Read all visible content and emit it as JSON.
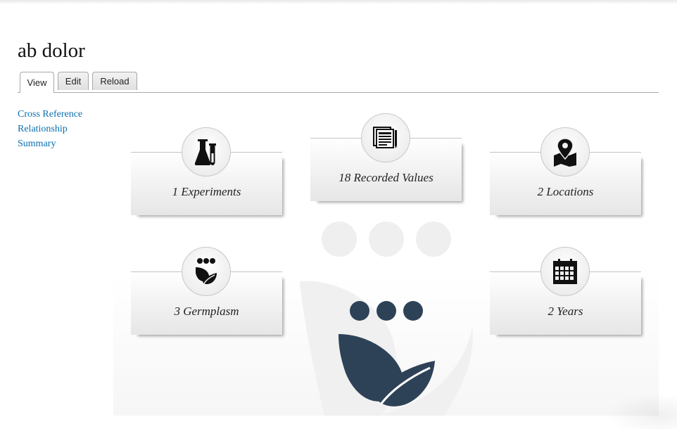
{
  "page": {
    "title": "ab dolor"
  },
  "tabs": [
    {
      "label": "View",
      "active": true
    },
    {
      "label": "Edit",
      "active": false
    },
    {
      "label": "Reload",
      "active": false
    }
  ],
  "sidebar": {
    "links": [
      "Cross Reference",
      "Relationship",
      "Summary"
    ]
  },
  "cards": [
    {
      "label": "1 Experiments",
      "icon": "lab-flask-icon"
    },
    {
      "label": "18 Recorded Values",
      "icon": "documents-icon"
    },
    {
      "label": "2 Locations",
      "icon": "map-pin-icon"
    },
    {
      "label": "3 Germplasm",
      "icon": "germplasm-leaf-icon"
    },
    {
      "label": "2 Years",
      "icon": "calendar-icon"
    }
  ],
  "colors": {
    "icon": "#111111",
    "brand": "#2e4257",
    "link": "#0a6fb0"
  }
}
